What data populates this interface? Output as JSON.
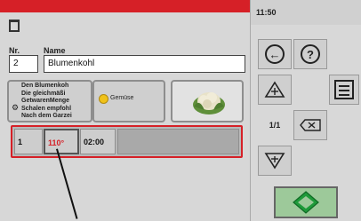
{
  "form": {
    "nr_label": "Nr.",
    "name_label": "Name",
    "nr_value": "2",
    "name_value": "Blumenkohl"
  },
  "description": {
    "text": "Den Blumenkoh\nDie gleichmäßi\nGetwarenMenge\nSchalen empfohl\nNach dem Garzei"
  },
  "category": {
    "label": "Gemüse"
  },
  "step": {
    "number": "1",
    "temperature": "110°",
    "time": "02:00"
  },
  "sidebar": {
    "clock": "11:50",
    "page_indicator": "1/1"
  },
  "colors": {
    "accent": "#d62027",
    "start": "#1f9a3a"
  }
}
